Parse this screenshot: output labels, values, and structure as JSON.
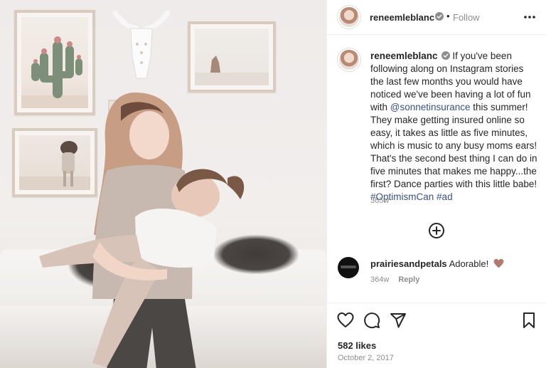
{
  "post": {
    "username": "reneemleblanc",
    "follow_label": "Follow",
    "separator": "•",
    "caption": {
      "before_mention": "If you've been following along on Instagram stories the last few months you would have noticed we've been having a lot of fun with ",
      "mention": "@sonnetinsurance",
      "after_mention": " this summer! They make getting insured online so easy, it takes as little as five minutes, which is music to any busy moms ears! That's the second best thing I can do in five minutes that makes me happy...the first? Dance parties with this little babe! ",
      "hashtag1": "#OptimismCan",
      "hashtag2": "#ad",
      "time": "365w"
    },
    "comment": {
      "username": "prairiesandpetals",
      "text": "Adorable!",
      "time": "364w",
      "reply_label": "Reply"
    },
    "likes": "582 likes",
    "date": "October 2, 2017"
  },
  "icons": {
    "verified": "verified-badge-icon",
    "more": "more-options-icon",
    "load_more": "plus-circle-icon",
    "like": "heart-icon",
    "comment": "comment-icon",
    "share": "paper-plane-icon",
    "save": "bookmark-icon"
  },
  "colors": {
    "text": "#262626",
    "muted": "#8e8e8e",
    "link": "#385185",
    "heart": "#b07a6e"
  }
}
